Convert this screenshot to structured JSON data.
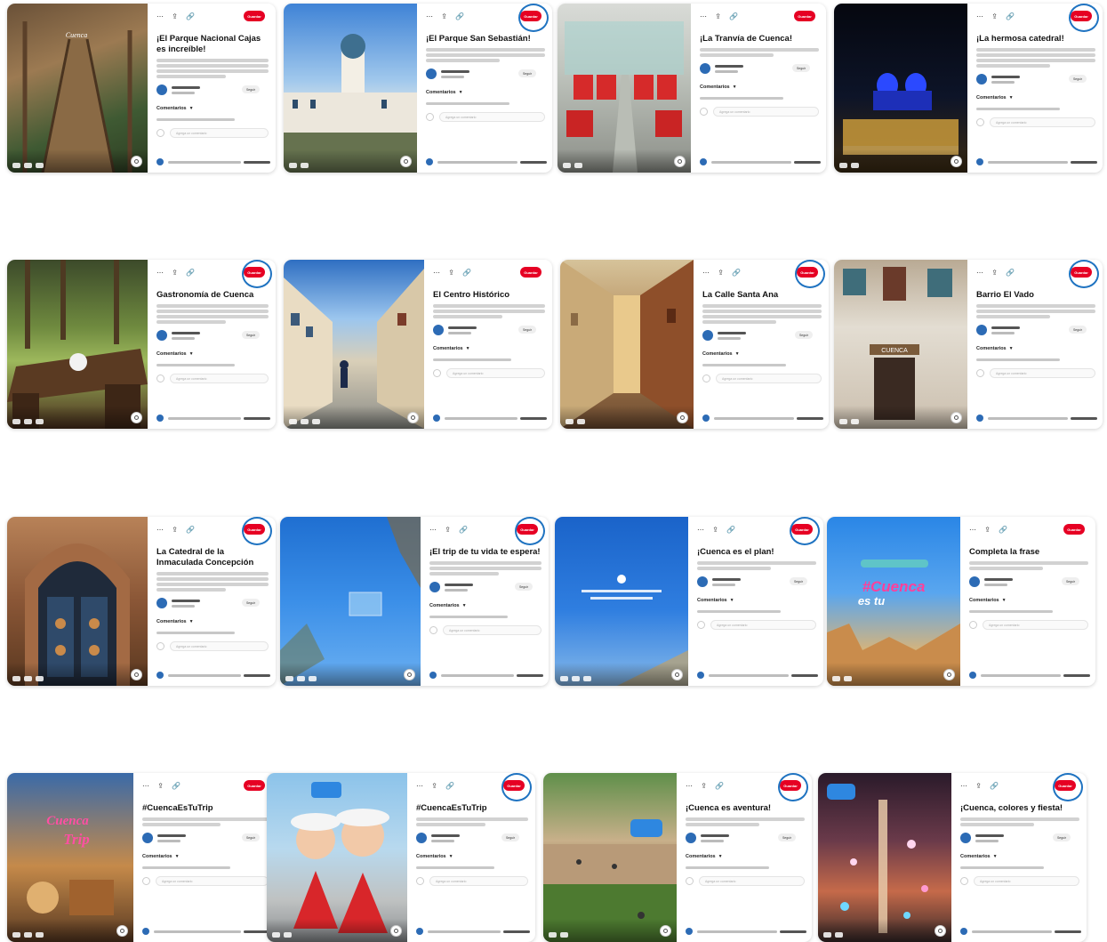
{
  "ui": {
    "save_label": "Guardar",
    "follow_label": "Seguir",
    "comments_label": "Comentarios",
    "reply_placeholder": "Agrega un comentario",
    "back_icon": "more-icon",
    "share_icon": "share-icon",
    "link_icon": "link-icon"
  },
  "colors": {
    "save": "#e60023",
    "ring": "#1f73c1",
    "avatar": "#2c6bb5"
  },
  "pins": [
    {
      "title": "¡El Parque Nacional Cajas es increíble!",
      "ring": false
    },
    {
      "title": "¡El Parque San Sebastián!",
      "ring": true
    },
    {
      "title": "¡La Tranvía de Cuenca!",
      "ring": false
    },
    {
      "title": "¡La hermosa catedral!",
      "ring": true
    },
    {
      "title": "Gastronomía de Cuenca",
      "ring": true
    },
    {
      "title": "El Centro Histórico",
      "ring": false
    },
    {
      "title": "La Calle Santa Ana",
      "ring": true
    },
    {
      "title": "Barrio El Vado",
      "ring": true
    },
    {
      "title": "La Catedral de la Inmaculada Concepción",
      "ring": true
    },
    {
      "title": "¡El trip de tu vida te espera!",
      "ring": true
    },
    {
      "title": "¡Cuenca es el plan!",
      "ring": true
    },
    {
      "title": "Completa la frase",
      "ring": false
    },
    {
      "title": "#CuencaEsTuTrip",
      "ring": false
    },
    {
      "title": "#CuencaEsTuTrip",
      "ring": true
    },
    {
      "title": "¡Cuenca es aventura!",
      "ring": true
    },
    {
      "title": "¡Cuenca, colores y fiesta!",
      "ring": true
    }
  ]
}
